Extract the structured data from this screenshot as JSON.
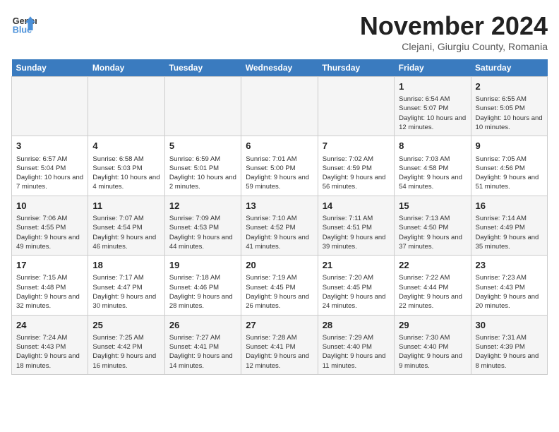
{
  "header": {
    "logo_line1": "General",
    "logo_line2": "Blue",
    "month_year": "November 2024",
    "location": "Clejani, Giurgiu County, Romania"
  },
  "weekdays": [
    "Sunday",
    "Monday",
    "Tuesday",
    "Wednesday",
    "Thursday",
    "Friday",
    "Saturday"
  ],
  "weeks": [
    [
      {
        "day": "",
        "info": ""
      },
      {
        "day": "",
        "info": ""
      },
      {
        "day": "",
        "info": ""
      },
      {
        "day": "",
        "info": ""
      },
      {
        "day": "",
        "info": ""
      },
      {
        "day": "1",
        "info": "Sunrise: 6:54 AM\nSunset: 5:07 PM\nDaylight: 10 hours and 12 minutes."
      },
      {
        "day": "2",
        "info": "Sunrise: 6:55 AM\nSunset: 5:05 PM\nDaylight: 10 hours and 10 minutes."
      }
    ],
    [
      {
        "day": "3",
        "info": "Sunrise: 6:57 AM\nSunset: 5:04 PM\nDaylight: 10 hours and 7 minutes."
      },
      {
        "day": "4",
        "info": "Sunrise: 6:58 AM\nSunset: 5:03 PM\nDaylight: 10 hours and 4 minutes."
      },
      {
        "day": "5",
        "info": "Sunrise: 6:59 AM\nSunset: 5:01 PM\nDaylight: 10 hours and 2 minutes."
      },
      {
        "day": "6",
        "info": "Sunrise: 7:01 AM\nSunset: 5:00 PM\nDaylight: 9 hours and 59 minutes."
      },
      {
        "day": "7",
        "info": "Sunrise: 7:02 AM\nSunset: 4:59 PM\nDaylight: 9 hours and 56 minutes."
      },
      {
        "day": "8",
        "info": "Sunrise: 7:03 AM\nSunset: 4:58 PM\nDaylight: 9 hours and 54 minutes."
      },
      {
        "day": "9",
        "info": "Sunrise: 7:05 AM\nSunset: 4:56 PM\nDaylight: 9 hours and 51 minutes."
      }
    ],
    [
      {
        "day": "10",
        "info": "Sunrise: 7:06 AM\nSunset: 4:55 PM\nDaylight: 9 hours and 49 minutes."
      },
      {
        "day": "11",
        "info": "Sunrise: 7:07 AM\nSunset: 4:54 PM\nDaylight: 9 hours and 46 minutes."
      },
      {
        "day": "12",
        "info": "Sunrise: 7:09 AM\nSunset: 4:53 PM\nDaylight: 9 hours and 44 minutes."
      },
      {
        "day": "13",
        "info": "Sunrise: 7:10 AM\nSunset: 4:52 PM\nDaylight: 9 hours and 41 minutes."
      },
      {
        "day": "14",
        "info": "Sunrise: 7:11 AM\nSunset: 4:51 PM\nDaylight: 9 hours and 39 minutes."
      },
      {
        "day": "15",
        "info": "Sunrise: 7:13 AM\nSunset: 4:50 PM\nDaylight: 9 hours and 37 minutes."
      },
      {
        "day": "16",
        "info": "Sunrise: 7:14 AM\nSunset: 4:49 PM\nDaylight: 9 hours and 35 minutes."
      }
    ],
    [
      {
        "day": "17",
        "info": "Sunrise: 7:15 AM\nSunset: 4:48 PM\nDaylight: 9 hours and 32 minutes."
      },
      {
        "day": "18",
        "info": "Sunrise: 7:17 AM\nSunset: 4:47 PM\nDaylight: 9 hours and 30 minutes."
      },
      {
        "day": "19",
        "info": "Sunrise: 7:18 AM\nSunset: 4:46 PM\nDaylight: 9 hours and 28 minutes."
      },
      {
        "day": "20",
        "info": "Sunrise: 7:19 AM\nSunset: 4:45 PM\nDaylight: 9 hours and 26 minutes."
      },
      {
        "day": "21",
        "info": "Sunrise: 7:20 AM\nSunset: 4:45 PM\nDaylight: 9 hours and 24 minutes."
      },
      {
        "day": "22",
        "info": "Sunrise: 7:22 AM\nSunset: 4:44 PM\nDaylight: 9 hours and 22 minutes."
      },
      {
        "day": "23",
        "info": "Sunrise: 7:23 AM\nSunset: 4:43 PM\nDaylight: 9 hours and 20 minutes."
      }
    ],
    [
      {
        "day": "24",
        "info": "Sunrise: 7:24 AM\nSunset: 4:43 PM\nDaylight: 9 hours and 18 minutes."
      },
      {
        "day": "25",
        "info": "Sunrise: 7:25 AM\nSunset: 4:42 PM\nDaylight: 9 hours and 16 minutes."
      },
      {
        "day": "26",
        "info": "Sunrise: 7:27 AM\nSunset: 4:41 PM\nDaylight: 9 hours and 14 minutes."
      },
      {
        "day": "27",
        "info": "Sunrise: 7:28 AM\nSunset: 4:41 PM\nDaylight: 9 hours and 12 minutes."
      },
      {
        "day": "28",
        "info": "Sunrise: 7:29 AM\nSunset: 4:40 PM\nDaylight: 9 hours and 11 minutes."
      },
      {
        "day": "29",
        "info": "Sunrise: 7:30 AM\nSunset: 4:40 PM\nDaylight: 9 hours and 9 minutes."
      },
      {
        "day": "30",
        "info": "Sunrise: 7:31 AM\nSunset: 4:39 PM\nDaylight: 9 hours and 8 minutes."
      }
    ]
  ]
}
